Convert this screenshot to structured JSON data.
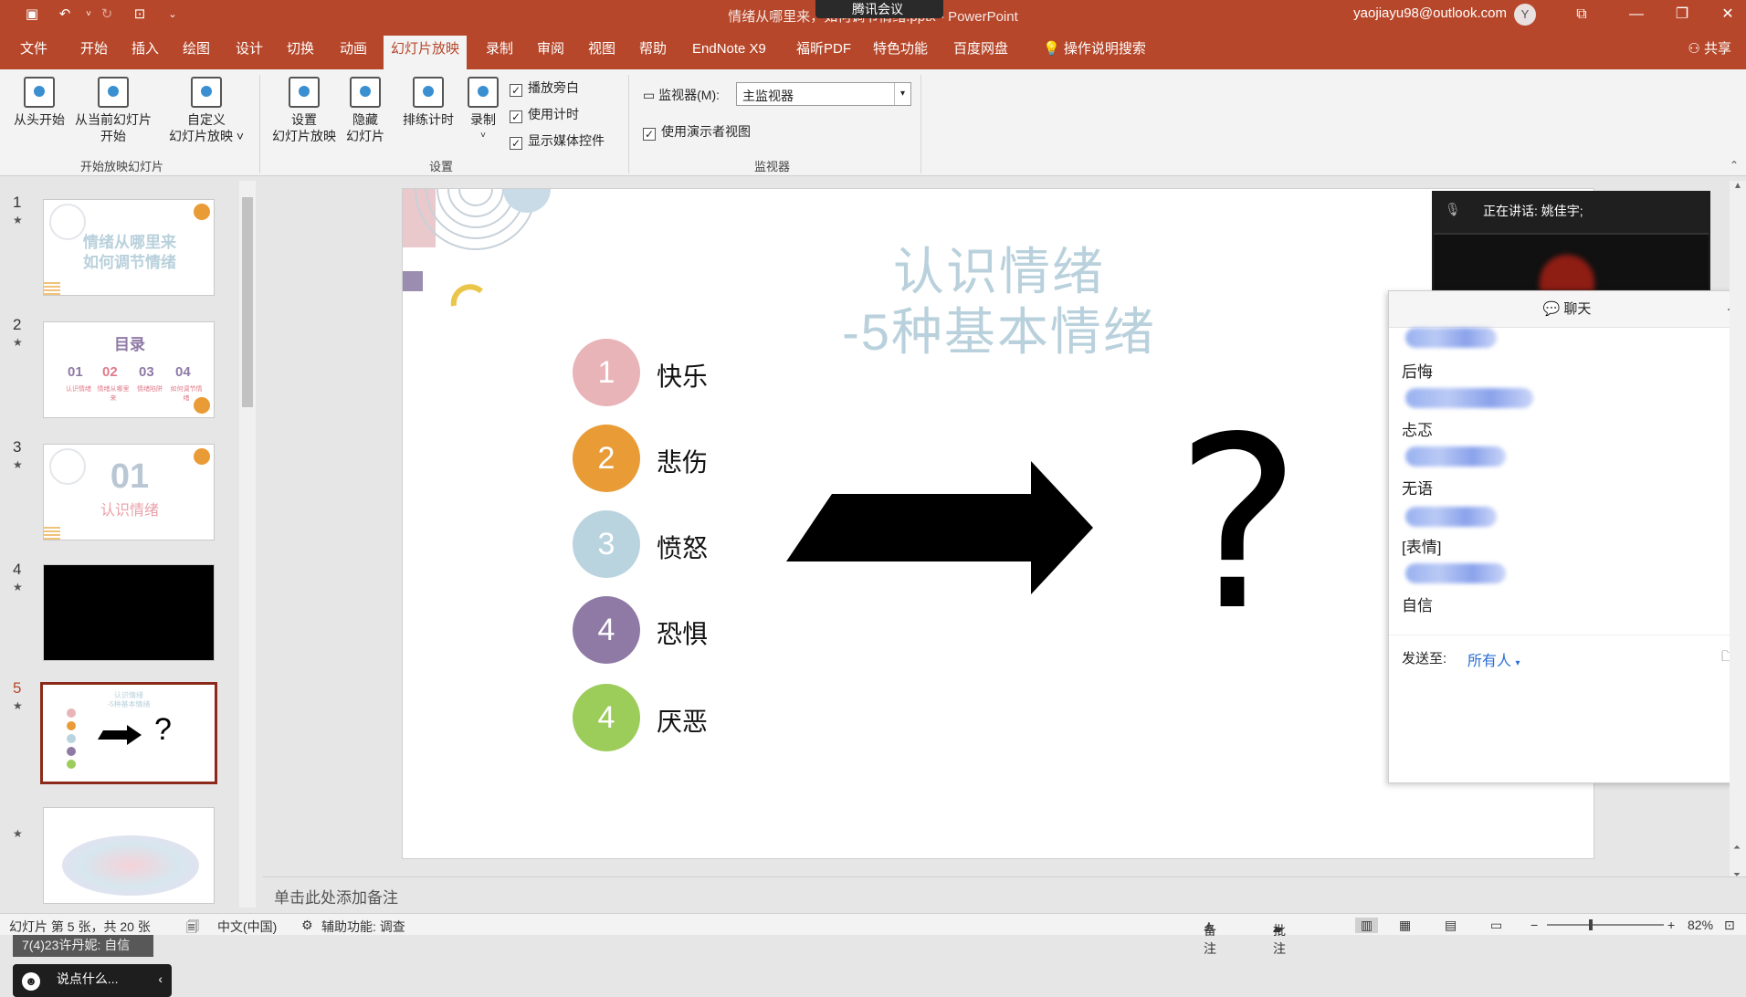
{
  "app": {
    "window_title": "情绪从哪里来，如何调节情绪.pptx - PowerPoint",
    "tencent_meeting": "腾讯会议",
    "user_email": "yaojiayu98@outlook.com",
    "user_avatar": "Y",
    "share_label": "共享",
    "search_label": "操作说明搜索"
  },
  "tabs": [
    "文件",
    "开始",
    "插入",
    "绘图",
    "设计",
    "切换",
    "动画",
    "幻灯片放映",
    "录制",
    "审阅",
    "视图",
    "帮助",
    "EndNote X9",
    "福昕PDF",
    "特色功能",
    "百度网盘"
  ],
  "active_tab": "幻灯片放映",
  "ribbon": {
    "groups": {
      "start": "开始放映幻灯片",
      "setup": "设置",
      "monitor": "监视器"
    },
    "buttons": {
      "from_start": "从头开始",
      "from_current_1": "从当前幻灯片",
      "from_current_2": "开始",
      "custom_1": "自定义",
      "custom_2": "幻灯片放映 ˅",
      "setup_1": "设置",
      "setup_2": "幻灯片放映",
      "hide_1": "隐藏",
      "hide_2": "幻灯片",
      "rehearse": "排练计时",
      "record": "录制"
    },
    "checkboxes": {
      "narration": "播放旁白",
      "timings": "使用计时",
      "media": "显示媒体控件",
      "presenter": "使用演示者视图"
    },
    "monitor_label": "监视器(M):",
    "monitor_value": "主监视器"
  },
  "thumbnails": [
    {
      "num": "1",
      "text1": "情绪从哪里来",
      "text2": "如何调节情绪"
    },
    {
      "num": "2",
      "text1": "目录",
      "items": [
        "01",
        "02",
        "03",
        "04"
      ],
      "captions": [
        "认识情绪",
        "情绪从哪里来",
        "情绪陷阱",
        "如何调节情绪"
      ]
    },
    {
      "num": "3",
      "text1": "01",
      "text2": "认识情绪"
    },
    {
      "num": "4"
    },
    {
      "num": "5"
    },
    {
      "num": ""
    }
  ],
  "slide": {
    "title_line1": "认识情绪",
    "title_line2": "-5种基本情绪",
    "emotions": [
      {
        "n": "1",
        "label": "快乐",
        "color": "#e8b4b8"
      },
      {
        "n": "2",
        "label": "悲伤",
        "color": "#e99b36"
      },
      {
        "n": "3",
        "label": "愤怒",
        "color": "#b9d4df"
      },
      {
        "n": "4",
        "label": "恐惧",
        "color": "#8f7aa6"
      },
      {
        "n": "4",
        "label": "厌恶",
        "color": "#9ccc5a"
      }
    ],
    "question_mark": "?"
  },
  "notes_placeholder": "单击此处添加备注",
  "floating": {
    "comment": "7(4)23许丹妮: 自信",
    "input_placeholder": "说点什么..."
  },
  "video": {
    "speaking": "正在讲话: 姚佳宇;"
  },
  "chat": {
    "title": "聊天",
    "messages": [
      "后悔",
      "忐忑",
      "无语",
      "[表情]",
      "自信"
    ],
    "send_to_label": "发送至:",
    "send_to_value": "所有人"
  },
  "status": {
    "slide_info": "幻灯片 第 5 张，共 20 张",
    "language": "中文(中国)",
    "accessibility": "辅助功能: 调查",
    "notes": "备注",
    "comments": "批注",
    "zoom": "82%"
  }
}
